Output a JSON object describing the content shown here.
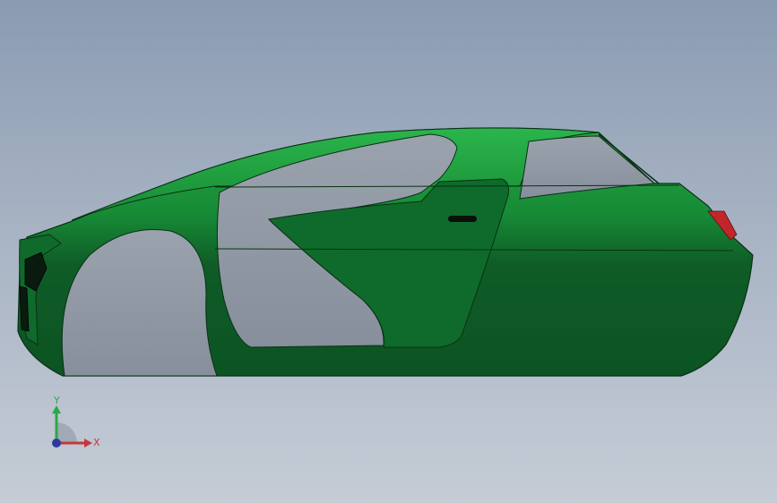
{
  "viewport": {
    "background_top": "#8a9bb2",
    "background_bottom": "#c5ccd6"
  },
  "model": {
    "body_color": "#0f5c27",
    "body_highlight": "#20a03e",
    "glass_color": "#8e97a3",
    "tail_light_color": "#c0262a"
  },
  "triad": {
    "y_label": "Y",
    "x_label": "X",
    "y_color": "#2aa84a",
    "x_color": "#c03a3a",
    "z_color": "#2c3aa0"
  }
}
